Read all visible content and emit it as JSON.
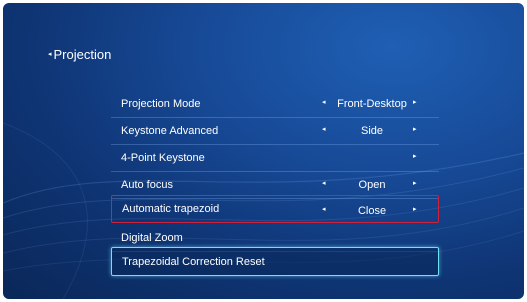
{
  "header": {
    "back_arrow": "◂",
    "title": "Projection"
  },
  "menu": {
    "items": [
      {
        "label": "Projection Mode",
        "left_arrow": "◂",
        "value": "Front-Desktop",
        "right_arrow": "▸"
      },
      {
        "label": "Keystone Advanced",
        "left_arrow": "◂",
        "value": "Side",
        "right_arrow": "▸"
      },
      {
        "label": "4-Point Keystone",
        "right_arrow": "▸"
      },
      {
        "label": "Auto focus",
        "left_arrow": "◂",
        "value": "Open",
        "right_arrow": "▸"
      },
      {
        "label": "Automatic trapezoid",
        "left_arrow": "◂",
        "value": "Close",
        "right_arrow": "▸"
      },
      {
        "label": "Digital Zoom"
      },
      {
        "label": "Trapezoidal Correction Reset"
      }
    ]
  },
  "colors": {
    "background": "#174a97",
    "highlight_red": "#d1203a",
    "selected_border": "#6fe1f0"
  }
}
